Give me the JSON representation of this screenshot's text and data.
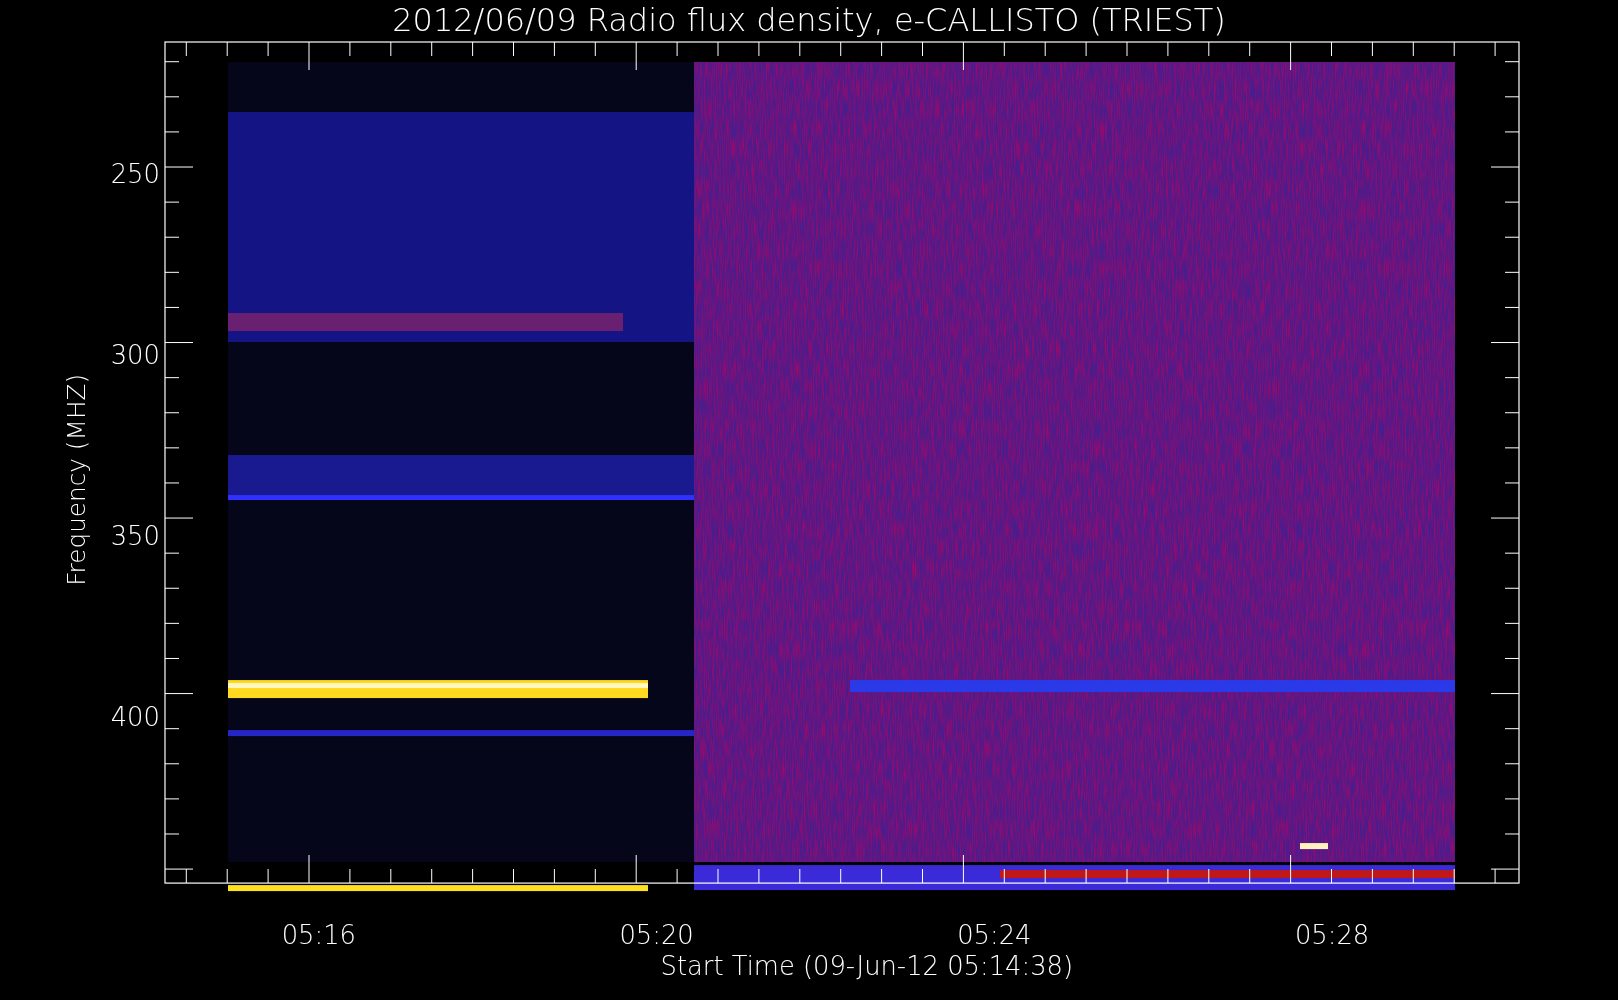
{
  "title": "2012/06/09  Radio flux density, e-CALLISTO (TRIEST)",
  "y_axis": {
    "label": "Frequency (MHZ)",
    "ticks": [
      "250",
      "300",
      "350",
      "400"
    ]
  },
  "x_axis": {
    "label": "Start Time (09-Jun-12 05:14:38)",
    "ticks": [
      "05:16",
      "05:20",
      "05:24",
      "05:28"
    ]
  }
}
